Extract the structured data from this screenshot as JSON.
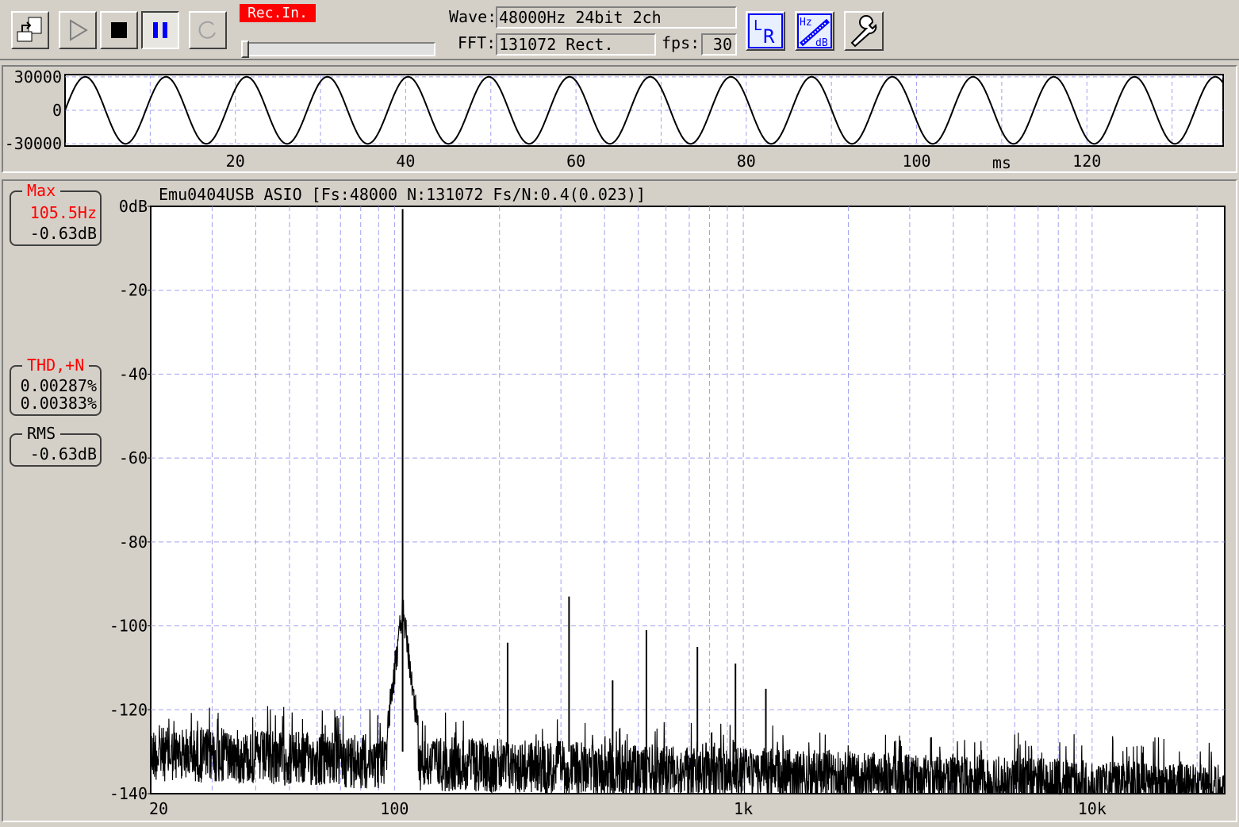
{
  "toolbar": {
    "rec_label": "Rec.In.",
    "wave_label": "Wave:",
    "wave_value": "48000Hz 24bit 2ch",
    "fft_label": "FFT:",
    "fft_value": "131072 Rect.",
    "fps_label": "fps:",
    "fps_value": "30",
    "icon_lr": "LR",
    "icon_hz": "Hz",
    "icon_db": "dB"
  },
  "wave_chart": {
    "y_ticks": [
      "30000",
      "0",
      "-30000"
    ],
    "x_ticks": [
      "20",
      "40",
      "60",
      "80",
      "100",
      "120"
    ],
    "x_unit": "ms"
  },
  "spectrum_chart": {
    "title": "Emu0404USB ASIO   [Fs:48000 N:131072 Fs/N:0.4(0.023)]",
    "y_ticks": [
      "0dB",
      "-20",
      "-40",
      "-60",
      "-80",
      "-100",
      "-120",
      "-140"
    ],
    "x_ticks": [
      "20",
      "100",
      "1k",
      "10k"
    ]
  },
  "readouts": {
    "max_title": "Max",
    "max_freq": "105.5Hz",
    "max_level": "-0.63dB",
    "thd_title": "THD,+N",
    "thd_value": "0.00287%",
    "thdn_value": "0.00383%",
    "rms_title": "RMS",
    "rms_value": "-0.63dB"
  },
  "colors": {
    "red": "#ff0000",
    "grid": "#a0a0f0",
    "blue_icon": "#0000ff"
  },
  "chart_data": [
    {
      "type": "line",
      "xlabel": "ms",
      "ylabel": "",
      "xlim": [
        0,
        136
      ],
      "ylim": [
        -32000,
        32000
      ],
      "series": [
        {
          "frequency_hz": 105.5,
          "amplitude": 30000
        }
      ]
    },
    {
      "type": "line",
      "title": "Emu0404USB ASIO   [Fs:48000 N:131072 Fs/N:0.4(0.023)]",
      "x_scale": "log",
      "xlim": [
        20,
        24000
      ],
      "ylim": [
        -140,
        0
      ],
      "peaks": [
        {
          "f": 105.5,
          "db": -0.63
        },
        {
          "f": 211,
          "db": -104
        },
        {
          "f": 316.5,
          "db": -93
        },
        {
          "f": 422,
          "db": -113
        },
        {
          "f": 527.5,
          "db": -101
        },
        {
          "f": 738.5,
          "db": -105
        },
        {
          "f": 949.5,
          "db": -109
        },
        {
          "f": 1160.5,
          "db": -115
        }
      ],
      "noise_floor_db": [
        -124,
        -134
      ]
    }
  ]
}
